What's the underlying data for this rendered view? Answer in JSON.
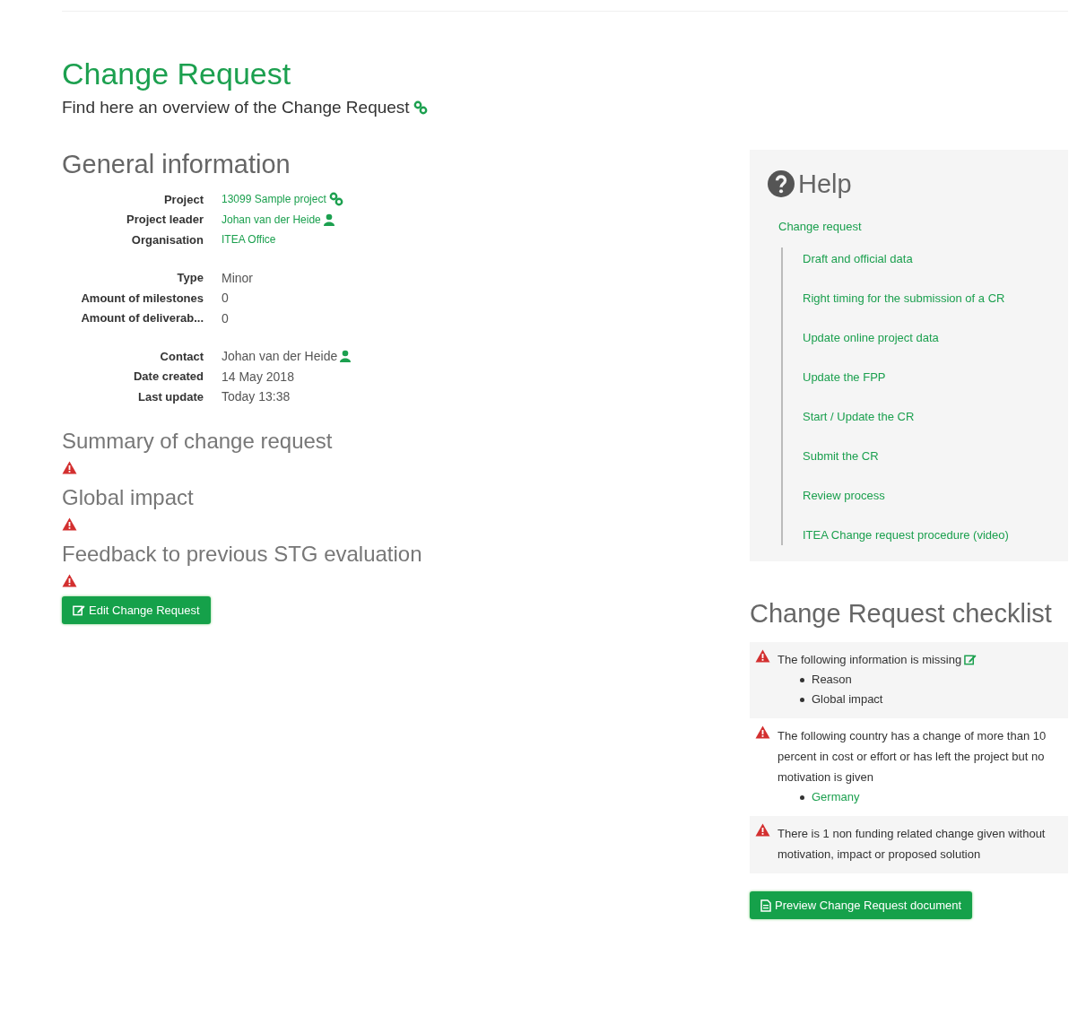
{
  "page": {
    "title": "Change Request",
    "subtitle": "Find here an overview of the Change Request"
  },
  "general": {
    "title": "General information",
    "groups": [
      [
        {
          "label": "Project",
          "value": "13099 Sample project",
          "kind": "project-link"
        },
        {
          "label": "Project leader",
          "value": "Johan van der Heide",
          "kind": "person-link"
        },
        {
          "label": "Organisation",
          "value": "ITEA Office",
          "kind": "link"
        }
      ],
      [
        {
          "label": "Type",
          "value": "Minor",
          "kind": "text"
        },
        {
          "label": "Amount of milestones",
          "value": "0",
          "kind": "text"
        },
        {
          "label": "Amount of deliverab...",
          "value": "0",
          "kind": "text"
        }
      ],
      [
        {
          "label": "Contact",
          "value": "Johan van der Heide",
          "kind": "person"
        },
        {
          "label": "Date created",
          "value": "14 May 2018",
          "kind": "text"
        },
        {
          "label": "Last update",
          "value": "Today 13:38",
          "kind": "text"
        }
      ]
    ]
  },
  "sections": [
    {
      "title": "Summary of change request",
      "missing": true
    },
    {
      "title": "Global impact",
      "missing": true
    },
    {
      "title": "Feedback to previous STG evaluation",
      "missing": true
    }
  ],
  "edit_button": "Edit Change Request",
  "help": {
    "title": "Help",
    "top": "Change request",
    "items": [
      "Draft and official data",
      "Right timing for the submission of a CR",
      "Update online project data",
      "Update the FPP",
      "Start / Update the CR",
      "Submit the CR",
      "Review process",
      "ITEA Change request procedure (video)"
    ]
  },
  "checklist": {
    "title": "Change Request checklist",
    "items": [
      {
        "text": "The following information is missing",
        "editable": true,
        "bullets": [
          {
            "text": "Reason",
            "kind": "text"
          },
          {
            "text": "Global impact",
            "kind": "text"
          }
        ]
      },
      {
        "text": "The following country has a change of more than 10 percent in cost or effort or has left the project but no motivation is given",
        "editable": false,
        "bullets": [
          {
            "text": "Germany",
            "kind": "link"
          }
        ]
      },
      {
        "text": "There is 1 non funding related change given without motivation, impact or proposed solution",
        "editable": false
      }
    ]
  },
  "preview_button": "Preview Change Request document"
}
